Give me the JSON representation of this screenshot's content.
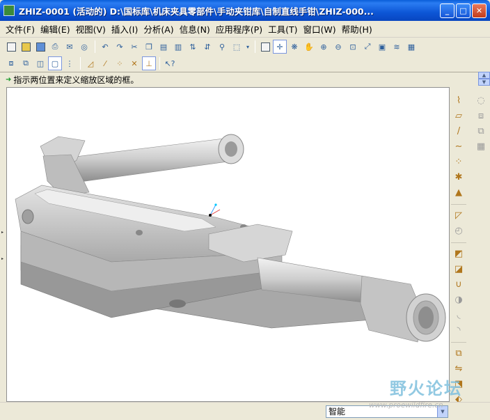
{
  "window": {
    "title": "ZHIZ-0001 (活动的) D:\\国标库\\机床夹具零部件\\手动夹钳库\\自制直线手钳\\ZHIZ-000...",
    "controls": [
      "_",
      "□",
      "✕"
    ]
  },
  "menu": [
    {
      "label": "文件(F)"
    },
    {
      "label": "编辑(E)"
    },
    {
      "label": "视图(V)"
    },
    {
      "label": "插入(I)"
    },
    {
      "label": "分析(A)"
    },
    {
      "label": "信息(N)"
    },
    {
      "label": "应用程序(P)"
    },
    {
      "label": "工具(T)"
    },
    {
      "label": "窗口(W)"
    },
    {
      "label": "帮助(H)"
    }
  ],
  "message": {
    "text": "指示两位置来定义缩放区域的框。"
  },
  "status": {
    "filter_value": "智能"
  },
  "watermark": {
    "brand": "野火论坛",
    "url": "www.proewildfire.cn"
  },
  "toolbar_icons_row1": [
    "new-file-icon",
    "open-icon",
    "save-icon",
    "print-icon",
    "send-mail-icon",
    "undo-icon",
    "redo-icon",
    "cut-icon",
    "copy-icon",
    "paste-icon",
    "regenerate-icon",
    "find-icon",
    "select-box-icon",
    "repaint-icon",
    "spin-center-icon",
    "orient-icon",
    "zoom-in-icon",
    "zoom-out-icon",
    "refit-icon",
    "reorient-icon",
    "saved-views-icon",
    "layers-icon",
    "appearance-icon"
  ],
  "toolbar_icons_row2": [
    "wireframe-icon",
    "hidden-line-icon",
    "no-hidden-icon",
    "shading-icon",
    "model-tree-icon",
    "datum-planes-icon",
    "datum-axes-icon",
    "datum-points-icon",
    "coord-sys-icon",
    "context-help-icon"
  ]
}
